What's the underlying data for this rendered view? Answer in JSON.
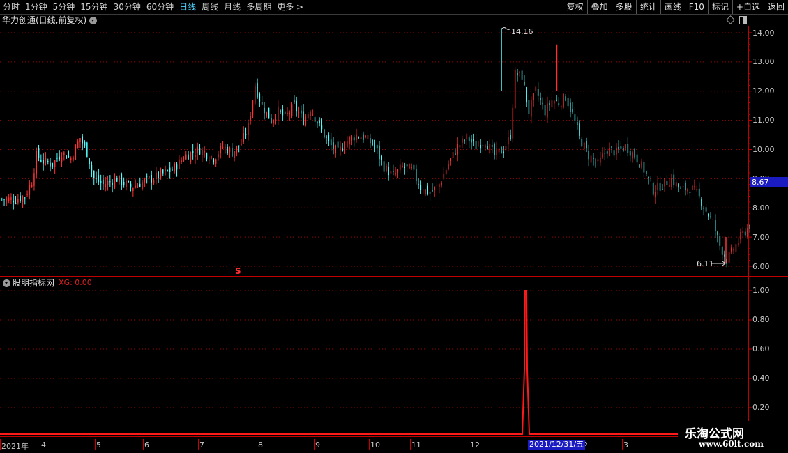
{
  "toolbar": {
    "periods": [
      "分时",
      "1分钟",
      "5分钟",
      "15分钟",
      "30分钟",
      "60分钟",
      "日线",
      "周线",
      "月线",
      "多周期",
      "更多 >"
    ],
    "active_period": "日线",
    "buttons": [
      "复权",
      "叠加",
      "多股",
      "统计",
      "画线",
      "F10",
      "标记",
      "+自选",
      "返回"
    ]
  },
  "main_panel": {
    "title": "华力创通(日线,前复权)",
    "current_price": "8.67",
    "high_label": "14.16",
    "low_label": "6.11",
    "signal_mark": "S",
    "price_axis": [
      "14.00",
      "13.00",
      "12.00",
      "11.00",
      "10.00",
      "9.00",
      "8.00",
      "7.00",
      "6.00"
    ]
  },
  "indicator_panel": {
    "title": "股朋指标网",
    "xg_label": "XG: 0.00",
    "axis": [
      "1.00",
      "0.80",
      "0.60",
      "0.40",
      "0.20"
    ]
  },
  "time_axis": {
    "ticks": [
      "2021年",
      "4",
      "5",
      "6",
      "7",
      "8",
      "9",
      "10",
      "11",
      "12",
      "2",
      "3"
    ],
    "highlight_date": "2021/12/31/五"
  },
  "watermark": {
    "title": "乐淘公式网",
    "url": "www.60lt.com"
  },
  "colors": {
    "up": "#ff3232",
    "down": "#54ffff",
    "grid": "#a00000",
    "axis": "#c00000",
    "highlight": "#1b1bc2"
  }
}
